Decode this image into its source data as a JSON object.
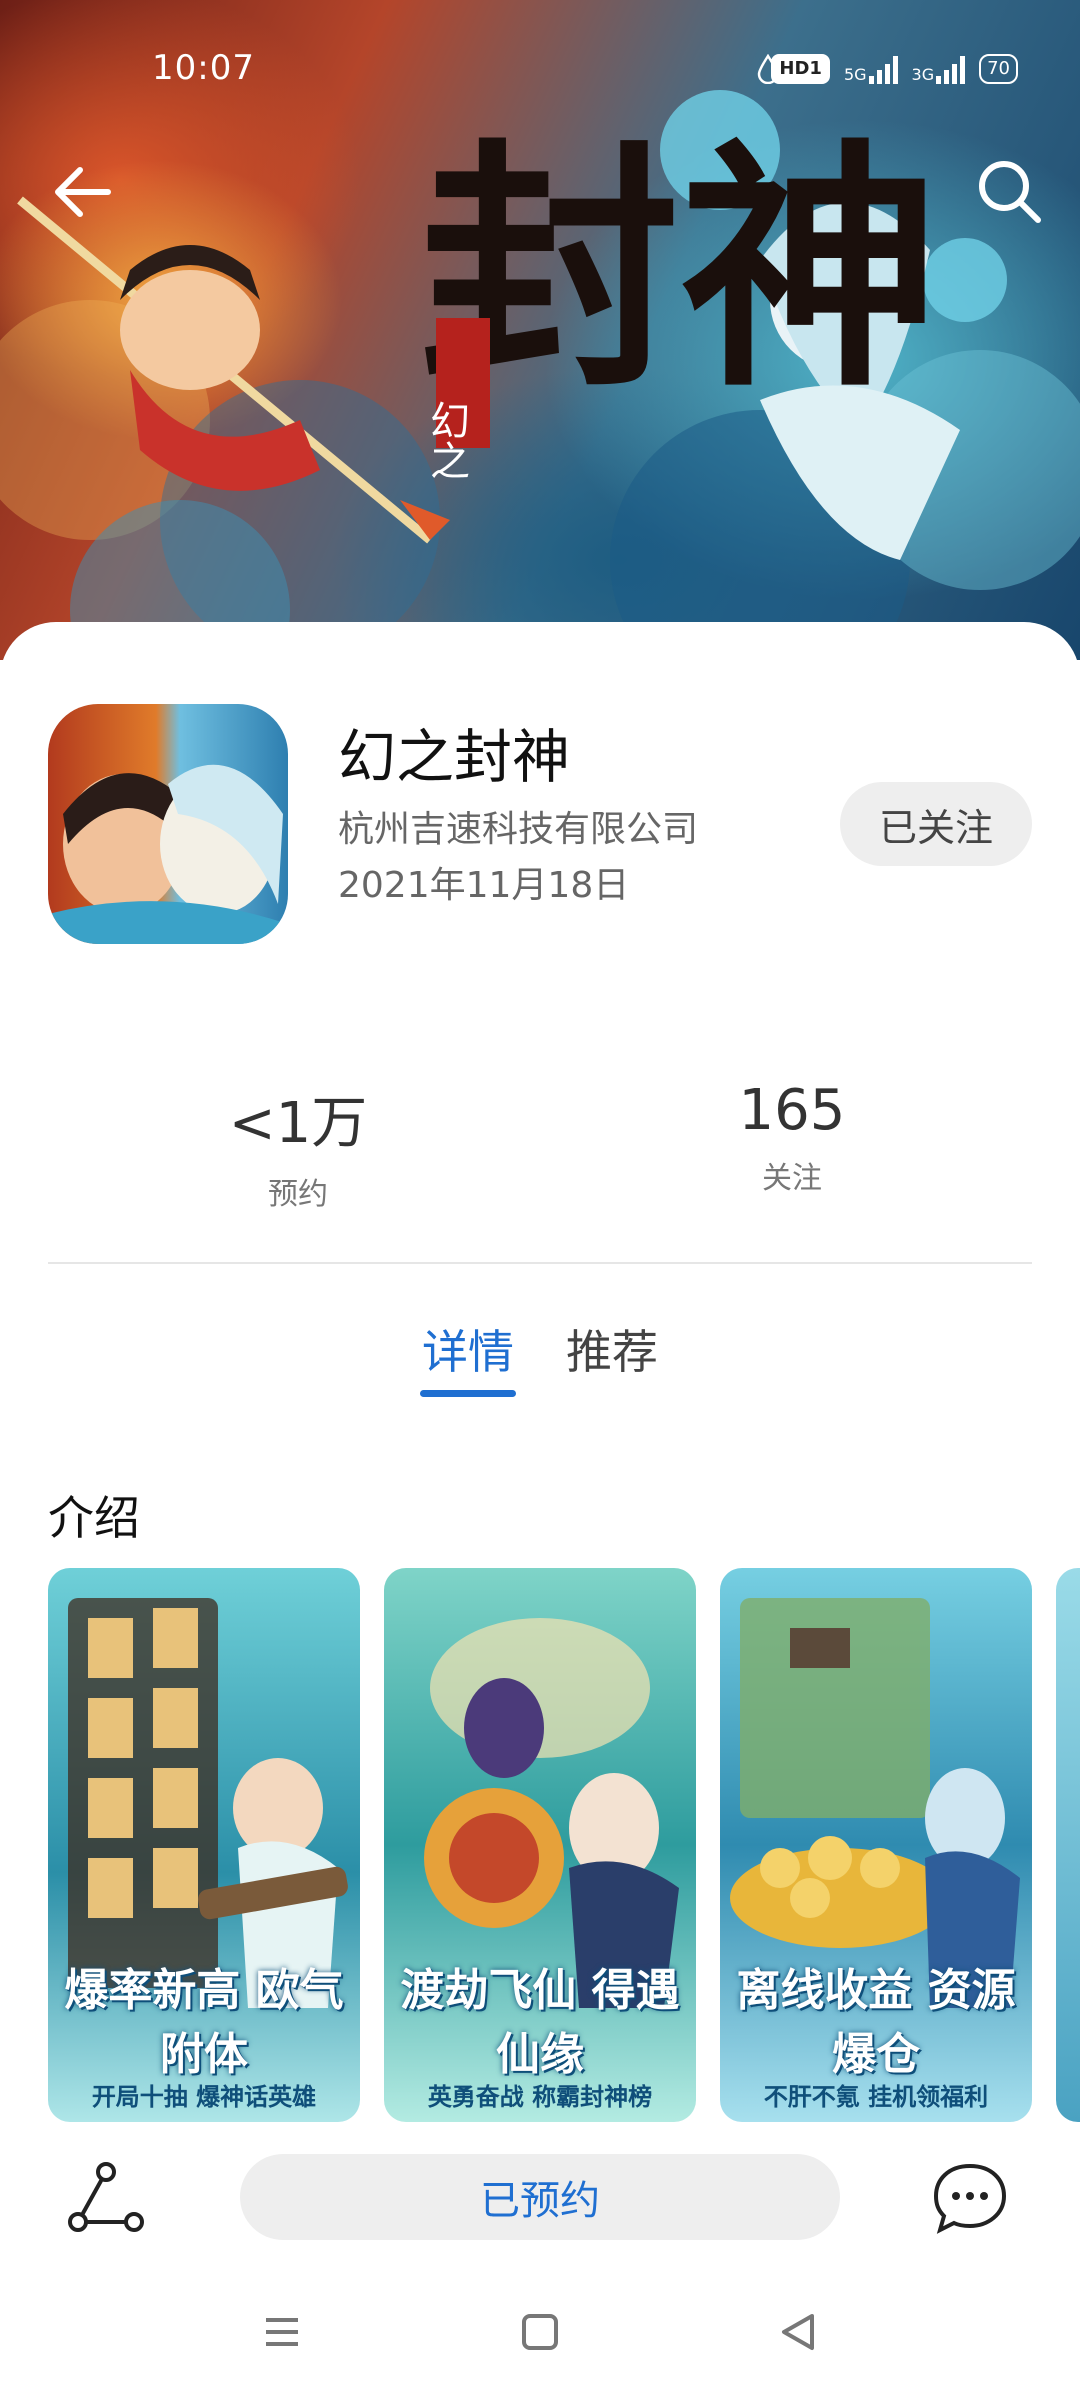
{
  "status_bar": {
    "time": "10:07",
    "hd_label": "HD1",
    "net1": "5G",
    "net2": "3G",
    "battery": "70"
  },
  "hero": {
    "title_art": "封神",
    "title_small": "幻之"
  },
  "app": {
    "name": "幻之封神",
    "developer": "杭州吉速科技有限公司",
    "date": "2021年11月18日",
    "follow_label": "已关注"
  },
  "stats": {
    "reservations": {
      "value": "<1万",
      "label": "预约"
    },
    "followers": {
      "value": "165",
      "label": "关注"
    }
  },
  "tabs": [
    {
      "label": "详情",
      "active": true
    },
    {
      "label": "推荐",
      "active": false
    }
  ],
  "section": {
    "intro_title": "介绍"
  },
  "screenshots": [
    {
      "caption": "爆率新高 欧气附体",
      "sub": "开局十抽 爆神话英雄"
    },
    {
      "caption": "渡劫飞仙 得遇仙缘",
      "sub": "英勇奋战 称霸封神榜"
    },
    {
      "caption": "离线收益 资源爆仓",
      "sub": "不肝不氪 挂机领福利"
    }
  ],
  "bottom_bar": {
    "reserve_label": "已预约"
  },
  "colors": {
    "accent": "#1f6fd1",
    "button_bg": "#eeeeee"
  },
  "icons": [
    "back-arrow-icon",
    "search-icon",
    "share-icon",
    "comment-icon",
    "menu-icon",
    "home-icon",
    "back-triangle-icon"
  ]
}
